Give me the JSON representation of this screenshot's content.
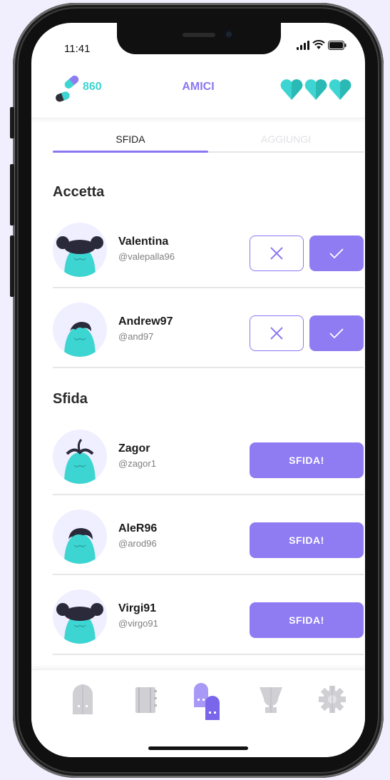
{
  "status_bar": {
    "time": "11:41"
  },
  "header": {
    "pills_count": "860",
    "title": "AMICI",
    "hearts": 3
  },
  "tabs": [
    {
      "label": "SFIDA",
      "active": true
    },
    {
      "label": "AGGIUNGI",
      "active": false
    }
  ],
  "accept_section": {
    "title": "Accetta",
    "requests": [
      {
        "name": "Valentina",
        "handle": "@valepalla96",
        "avatar": "buns-hair-avatar"
      },
      {
        "name": "Andrew97",
        "handle": "@and97",
        "avatar": "short-hair-avatar"
      }
    ]
  },
  "challenge_section": {
    "title": "Sfida",
    "button_label": "SFIDA!",
    "friends": [
      {
        "name": "Zagor",
        "handle": "@zagor1",
        "avatar": "sprout-hair-avatar"
      },
      {
        "name": "AleR96",
        "handle": "@arod96",
        "avatar": "short-hair-avatar"
      },
      {
        "name": "Virgi91",
        "handle": "@virgo91",
        "avatar": "buns-hair-avatar"
      }
    ]
  },
  "bottom_nav": [
    {
      "icon": "door-icon",
      "active": false
    },
    {
      "icon": "notebook-icon",
      "active": false
    },
    {
      "icon": "friends-icon",
      "active": true
    },
    {
      "icon": "trophy-icon",
      "active": false
    },
    {
      "icon": "gear-icon",
      "active": false
    }
  ],
  "colors": {
    "accent": "#8f7cf2",
    "teal": "#3dd5d1",
    "inactive_icon": "#cfcfd4"
  }
}
